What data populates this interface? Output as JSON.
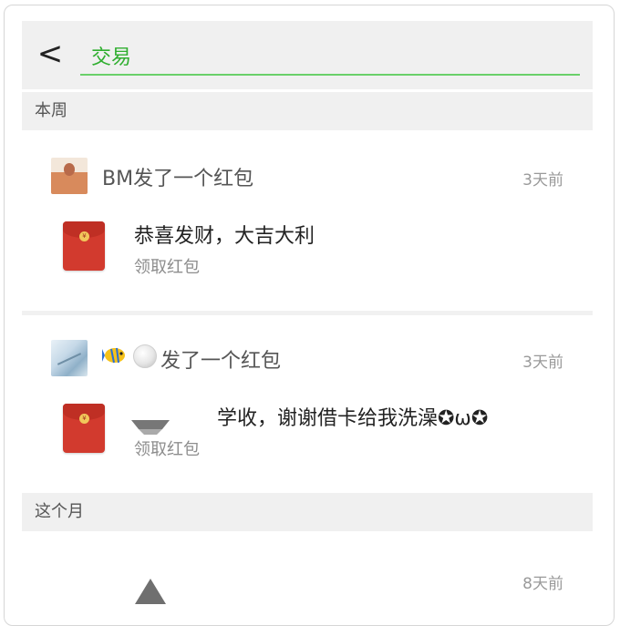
{
  "header": {
    "back_label": "<",
    "search_value": "交易"
  },
  "sections": {
    "this_week": "本周",
    "this_month": "这个月"
  },
  "items": [
    {
      "sender": "BM发了一个红包",
      "time": "3天前",
      "message": "恭喜发财，大吉大利",
      "claim": "领取红包"
    },
    {
      "sender": "发了一个红包",
      "time": "3天前",
      "message": "学收，谢谢借卡给我洗澡✪ω✪",
      "claim": "领取红包"
    },
    {
      "sender": "",
      "time": "8天前"
    }
  ],
  "icons": {
    "envelope_coin": "¥"
  },
  "colors": {
    "accent_green": "#2fae2f",
    "underline_green": "#6ad06a",
    "red_packet": "#d23a2e"
  }
}
